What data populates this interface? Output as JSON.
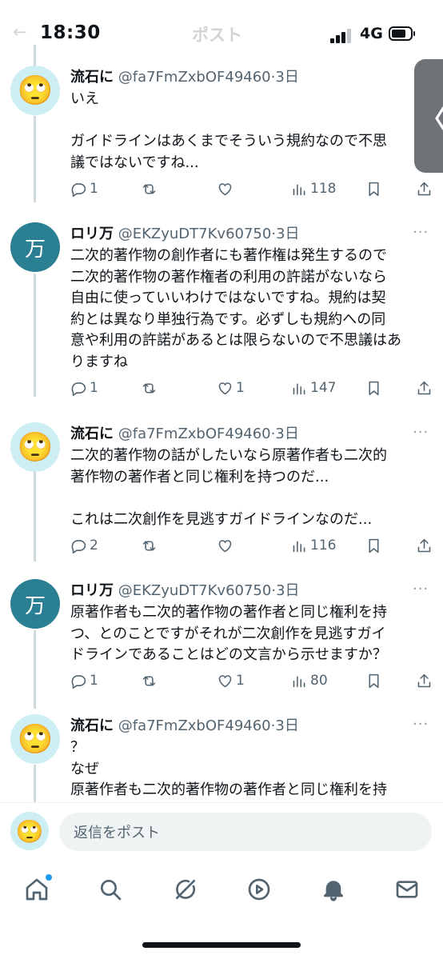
{
  "status": {
    "time": "18:30",
    "network": "4G",
    "battery_level": 0.75,
    "ghost_title": "ポスト"
  },
  "tweets": [
    {
      "name": "流石に",
      "handle": "@fa7FmZxbOF49460",
      "sep": "·",
      "age": "3日",
      "avatar": "🙄",
      "more": "···",
      "lines": [
        "いえ",
        "",
        "ガイドラインはあくまでそういう規約なので不思",
        "議ではないですね..."
      ],
      "replies": "1",
      "reposts": "",
      "likes": "",
      "views": "118"
    },
    {
      "name": "ロリ万",
      "handle": "@EKZyuDT7Kv60750",
      "sep": "·",
      "age": "3日",
      "avatar": "万",
      "more": "···",
      "lines": [
        "二次的著作物の創作者にも著作権は発生するので",
        "二次的著作物の著作権者の利用の許諾がないなら",
        "自由に使っていいわけではないですね。規約は契",
        "約とは異なり単独行為です。必ずしも規約への同",
        "意や利用の許諾があるとは限らないので不思議はあ",
        "りますね"
      ],
      "replies": "1",
      "reposts": "",
      "likes": "1",
      "views": "147"
    },
    {
      "name": "流石に",
      "handle": "@fa7FmZxbOF49460",
      "sep": "·",
      "age": "3日",
      "avatar": "🙄",
      "more": "···",
      "lines": [
        "二次的著作物の話がしたいなら原著作者も二次的",
        "著作物の著作者と同じ権利を持つのだ...",
        "",
        "これは二次創作を見逃すガイドラインなのだ..."
      ],
      "replies": "2",
      "reposts": "",
      "likes": "",
      "views": "116"
    },
    {
      "name": "ロリ万",
      "handle": "@EKZyuDT7Kv60750",
      "sep": "·",
      "age": "3日",
      "avatar": "万",
      "more": "···",
      "lines": [
        "原著作者も二次的著作物の著作者と同じ権利を持",
        "つ、とのことですがそれが二次創作を見逃すガイ",
        "ドラインであることはどの文言から示せますか？"
      ],
      "replies": "1",
      "reposts": "",
      "likes": "1",
      "views": "80"
    },
    {
      "name": "流石に",
      "handle": "@fa7FmZxbOF49460",
      "sep": "·",
      "age": "3日",
      "avatar": "🙄",
      "more": "···",
      "lines": [
        "？",
        "なぜ",
        "原著作者も二次的著作物の著作者と同じ権利を持"
      ]
    }
  ],
  "reply_bar": {
    "avatar": "🙄",
    "placeholder": "返信をポスト"
  },
  "pager": {
    "chevron": "〈"
  },
  "nav": [
    "home-icon",
    "search-icon",
    "grok-icon",
    "video-icon",
    "notifications-icon",
    "messages-icon"
  ]
}
